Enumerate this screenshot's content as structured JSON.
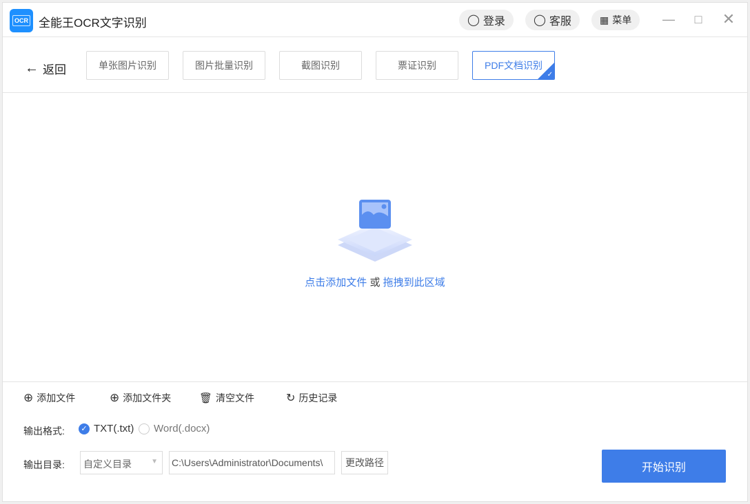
{
  "app": {
    "title": "全能王OCR文字识别",
    "logo_text": "OCR"
  },
  "header": {
    "login": "登录",
    "service": "客服",
    "menu": "菜单"
  },
  "nav": {
    "back": "返回",
    "tabs": [
      {
        "label": "单张图片识别"
      },
      {
        "label": "图片批量识别"
      },
      {
        "label": "截图识别"
      },
      {
        "label": "票证识别"
      },
      {
        "label": "PDF文档识别",
        "active": true
      }
    ]
  },
  "drop": {
    "click_text": "点击添加文件",
    "or": "或",
    "drag_text": "拖拽到此区域"
  },
  "toolbar": {
    "add_file": "添加文件",
    "add_folder": "添加文件夹",
    "clear": "清空文件",
    "history": "历史记录"
  },
  "output": {
    "format_label": "输出格式:",
    "formats": [
      {
        "label": "TXT(.txt)",
        "checked": true
      },
      {
        "label": "Word(.docx)",
        "checked": false
      }
    ],
    "dir_label": "输出目录:",
    "dir_option": "自定义目录",
    "path": "C:\\Users\\Administrator\\Documents\\",
    "change_path": "更改路径"
  },
  "start_button": "开始识别",
  "colors": {
    "accent": "#3e7de8",
    "logo": "#1e90ff"
  }
}
